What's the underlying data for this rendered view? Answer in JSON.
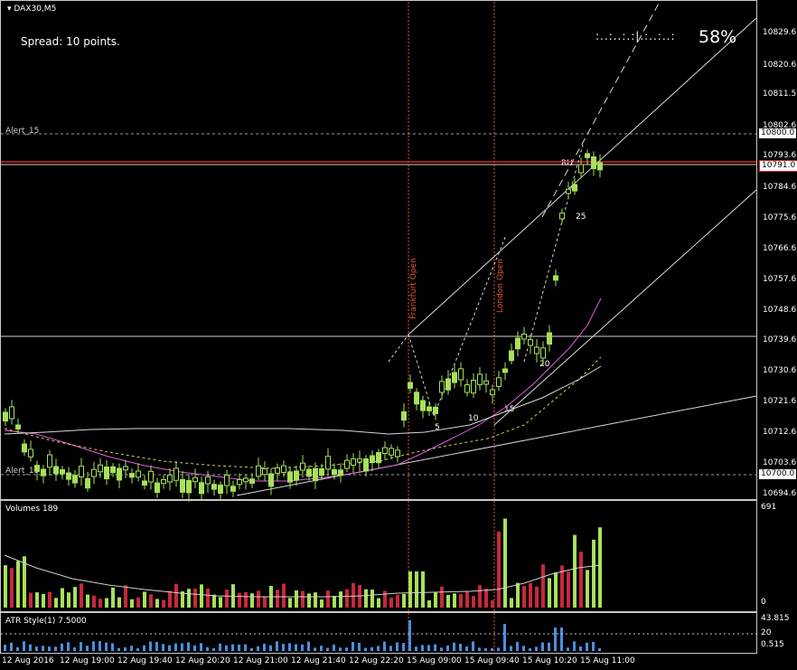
{
  "symbol": "DAX30,M5",
  "spread_text": "Spread: 10 points.",
  "timer_dots": ":..:..:.:|.:..:..:",
  "timer_percent": "58%",
  "alert_top": "Alert_15",
  "alert_bottom": "Alert_15",
  "session_labels": {
    "frankfurt": "Frankfurt Open",
    "london": "London Open"
  },
  "count_labels": [
    "5",
    "10",
    "15",
    "20",
    "25"
  ],
  "rh_label": "RH",
  "price_axis": [
    "10829.6",
    "10820.6",
    "10811.5",
    "10802.6",
    "10793.6",
    "10784.6",
    "10775.6",
    "10766.6",
    "10757.6",
    "10748.6",
    "10739.6",
    "10730.6",
    "10721.6",
    "10712.6",
    "10703.6",
    "10694.6"
  ],
  "price_tags": {
    "alert_top": "10800.0",
    "current": "10791.0",
    "alert_bottom": "10700.0"
  },
  "volumes_label": "Volumes 189",
  "volume_axis": {
    "max": "691",
    "min": "0"
  },
  "atr_label": "ATR Style(1) 7.5000",
  "atr_axis": {
    "max": "43.815",
    "mid": "20",
    "min": "0.515"
  },
  "time_axis": [
    "12 Aug 2016",
    "12 Aug 19:00",
    "12 Aug 19:40",
    "12 Aug 20:20",
    "12 Aug 21:00",
    "12 Aug 21:40",
    "12 Aug 22:20",
    "15 Aug 09:00",
    "15 Aug 09:40",
    "15 Aug 10:20",
    "15 Aug 11:00"
  ],
  "colors": {
    "bull": "#a8e05a",
    "bear": "#c8283c",
    "volume_bar": "#4a90e0",
    "session": "#e05a2a",
    "alert": "#c0c0c0",
    "current_line": "#e02020"
  }
}
